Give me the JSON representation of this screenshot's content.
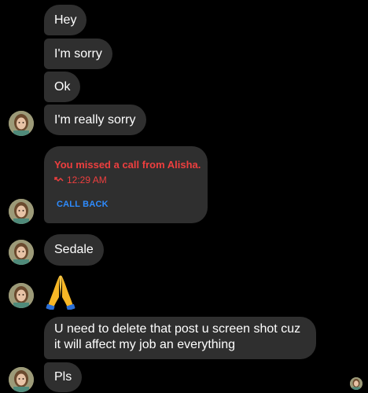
{
  "messages": {
    "m1": "Hey",
    "m2": "I'm sorry",
    "m3": "Ok",
    "m4": "I'm really sorry",
    "m5": "Sedale",
    "m6": "U need to delete that post u screen shot cuz it will affect my job an everything",
    "m7": "Pls"
  },
  "missed_call": {
    "title": "You missed a call from Alisha.",
    "time": "12:29 AM",
    "action": "CALL BACK",
    "icon": "missed-call-icon"
  },
  "reaction": {
    "emoji": "folded-hands",
    "icon": "pray-emoji-icon"
  },
  "colors": {
    "background": "#000000",
    "bubble": "#2f2f2f",
    "missed_call_red": "#ee3f3f",
    "call_back_blue": "#2e8cff",
    "text": "#ffffff"
  }
}
